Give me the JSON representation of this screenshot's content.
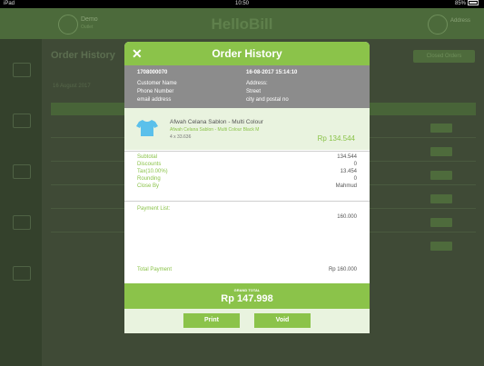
{
  "status": {
    "carrier": "iPad",
    "time": "10:50",
    "battery": "85%"
  },
  "header": {
    "brand": "HelloBill",
    "account_name": "Demo",
    "account_sub": "Outlet",
    "account2_name": "Address"
  },
  "background": {
    "page_title": "Order History",
    "button_label": "Closed Orders",
    "sub_label": "16 August 2017"
  },
  "modal": {
    "title": "Order History",
    "close_icon": "close-icon",
    "order_id": "1708000070",
    "order_datetime": "16-08-2017 15:14:10",
    "customer_name": "Customer Name",
    "phone_number": "Phone Number",
    "email_address": "email address",
    "address_label": "Address:",
    "street": "Street",
    "city_postal": "city and postal no",
    "item": {
      "name": "Afwah Celana Sablon - Multi Colour",
      "variant": "Afwah Celana Sablon - Multi Colour Black M",
      "qty": "4 x 33.636",
      "price": "Rp 134.544",
      "icon": "shirt-icon"
    },
    "summary": [
      {
        "label": "Subtotal",
        "value": "134.544"
      },
      {
        "label": "Discounts",
        "value": "0"
      },
      {
        "label": "Tax(10.00%)",
        "value": "13.454"
      },
      {
        "label": "Rounding",
        "value": "0"
      },
      {
        "label": "Close By",
        "value": "Mahmud"
      }
    ],
    "payment_list_label": "Payment List:",
    "payment_value": "160.000",
    "total_payment_label": "Total Payment",
    "total_payment_value": "Rp 160.000",
    "grand_total_label": "GRAND TOTAL",
    "grand_total_value": "Rp 147.998",
    "print_label": "Print",
    "void_label": "Void"
  },
  "colors": {
    "accent": "#8bc34a",
    "info_bg": "#8c8c8c",
    "item_bg": "#e9f3df"
  }
}
